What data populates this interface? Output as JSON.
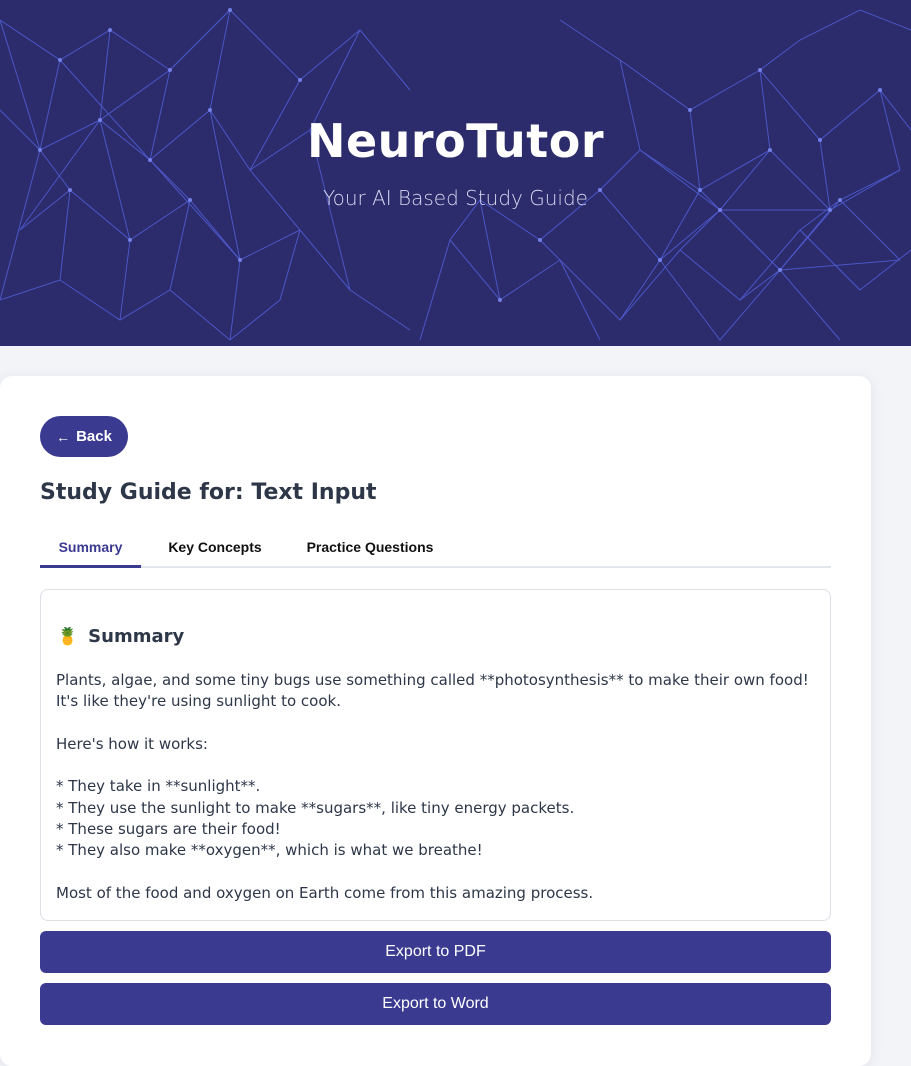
{
  "header": {
    "title": "NeuroTutor",
    "subtitle": "Your AI Based Study Guide"
  },
  "back_button": {
    "arrow": "←",
    "label": "Back"
  },
  "guide": {
    "title_prefix": "Study Guide for: ",
    "title_source": "Text Input"
  },
  "tabs": [
    {
      "label": "Summary",
      "active": true
    },
    {
      "label": "Key Concepts",
      "active": false
    },
    {
      "label": "Practice Questions",
      "active": false
    }
  ],
  "summary": {
    "icon": "pineapple-icon",
    "icon_glyph": "🍍",
    "heading": "Summary",
    "intro": "Plants, algae, and some tiny bugs use something called **photosynthesis** to make their own food! It's like they're using sunlight to cook.",
    "how_intro": "Here's how it works:",
    "bullets": [
      "* They take in **sunlight**.",
      "* They use the sunlight to make **sugars**, like tiny energy packets.",
      "* These sugars are their food!",
      "* They also make **oxygen**, which is what we breathe!"
    ],
    "conclusion": "Most of the food and oxygen on Earth come from this amazing process."
  },
  "actions": {
    "export_pdf": "Export to PDF",
    "export_word": "Export to Word"
  },
  "colors": {
    "hero_bg": "#2c2b6b",
    "accent": "#3b3a91",
    "network_line": "#4f5fe0"
  }
}
